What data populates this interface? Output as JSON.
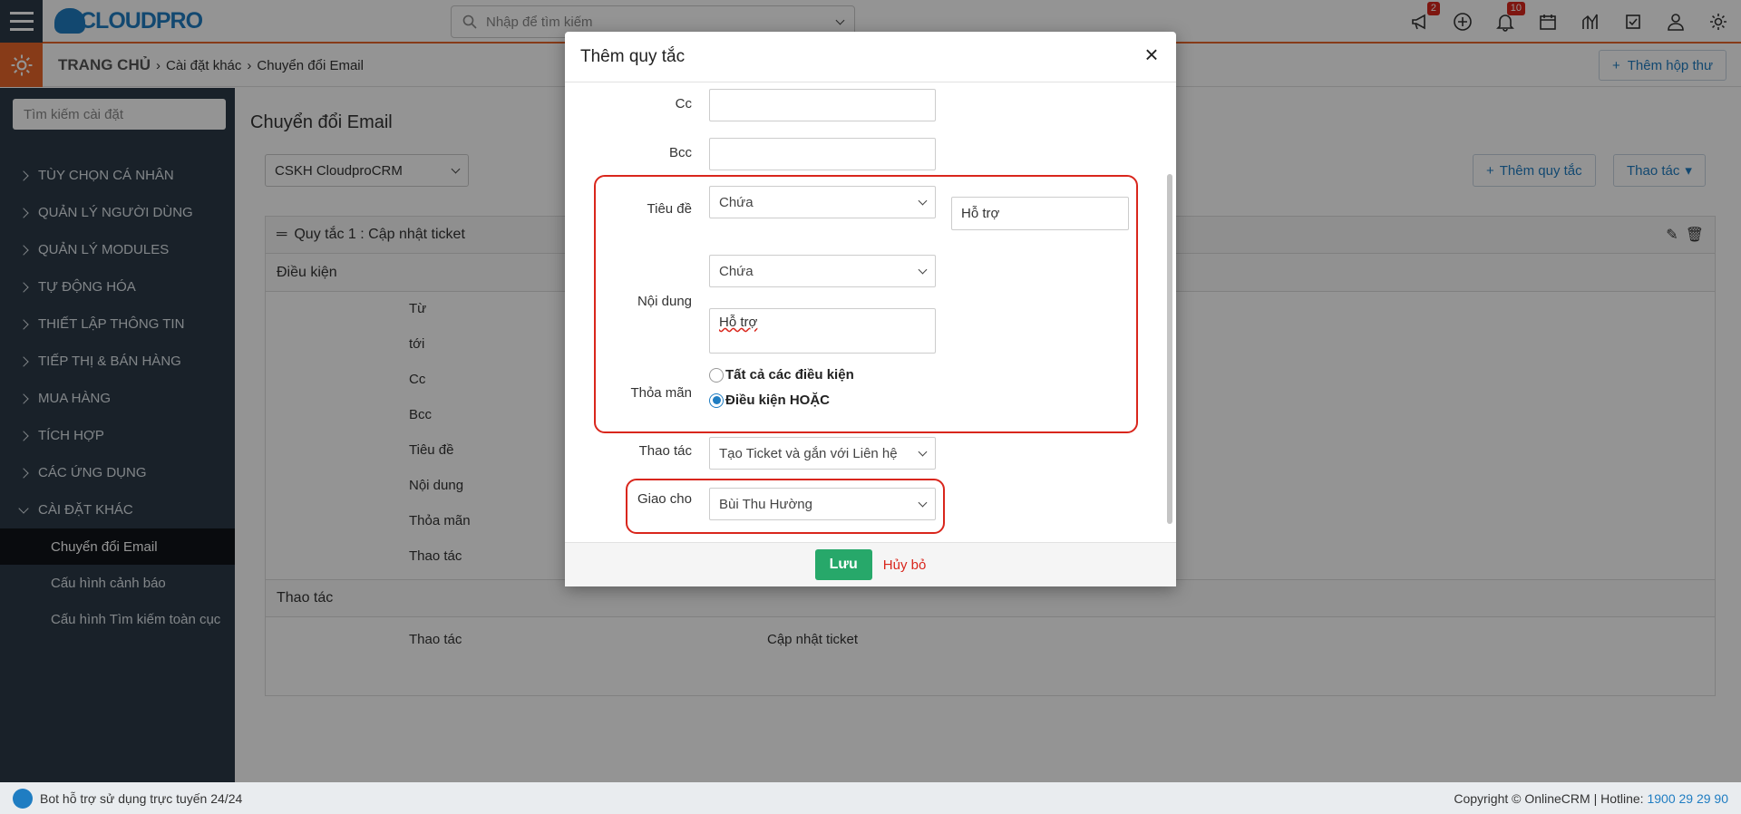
{
  "topbar": {
    "logo_text": "CLOUDPRO",
    "search_placeholder": "Nhập để tìm kiếm",
    "badges": {
      "announce": "2",
      "notifications": "10"
    }
  },
  "breadcrumb": {
    "home": "TRANG CHỦ",
    "level1": "Cài đặt khác",
    "level2": "Chuyển đổi Email",
    "add_mailbox": "Thêm hộp thư"
  },
  "sidebar": {
    "search_placeholder": "Tìm kiếm cài đặt",
    "items": [
      {
        "label": "TÙY CHỌN CÁ NHÂN"
      },
      {
        "label": "QUẢN LÝ NGƯỜI DÙNG"
      },
      {
        "label": "QUẢN LÝ MODULES"
      },
      {
        "label": "TỰ ĐỘNG HÓA"
      },
      {
        "label": "THIẾT LẬP THÔNG TIN"
      },
      {
        "label": "TIẾP THỊ & BÁN HÀNG"
      },
      {
        "label": "MUA HÀNG"
      },
      {
        "label": "TÍCH HỢP"
      },
      {
        "label": "CÁC ỨNG DỤNG"
      },
      {
        "label": "CÀI ĐẶT KHÁC"
      }
    ],
    "subitems": [
      {
        "label": "Chuyển đổi Email"
      },
      {
        "label": "Cấu hình cảnh báo"
      },
      {
        "label": "Cấu hình Tìm kiếm toàn cục"
      }
    ]
  },
  "main": {
    "title": "Chuyển đổi Email",
    "mailbox_select": "CSKH CloudproCRM",
    "add_rule": "Thêm quy tắc",
    "actions": "Thao tác",
    "rule_title": "Quy tắc 1 : Cập nhật ticket",
    "conditions_header": "Điều kiện",
    "condition_labels": [
      "Từ",
      "tới",
      "Cc",
      "Bcc",
      "Tiêu đề",
      "Nội dung",
      "Thỏa mãn",
      "Thao tác"
    ],
    "actions_header": "Thao tác",
    "action_label": "Thao tác",
    "action_value": "Cập nhật ticket"
  },
  "modal": {
    "title": "Thêm quy tắc",
    "labels": {
      "cc": "Cc",
      "bcc": "Bcc",
      "subject": "Tiêu đề",
      "body": "Nội dung",
      "match": "Thỏa mãn",
      "action": "Thao tác",
      "assign": "Giao cho"
    },
    "subject_op": "Chứa",
    "subject_value": "Hỗ trợ",
    "body_op": "Chứa",
    "body_value": "Hỗ trợ",
    "match_all": "Tất cả các điều kiện",
    "match_or": "Điều kiện HOẶC",
    "action_value": "Tạo Ticket và gắn với Liên hệ",
    "assign_value": "Bùi Thu Hường",
    "save": "Lưu",
    "cancel": "Hủy bỏ"
  },
  "footer": {
    "bot": "Bot hỗ trợ sử dụng trực tuyến 24/24",
    "copyright": "Copyright © OnlineCRM | Hotline:",
    "hotline": "1900 29 29 90"
  }
}
